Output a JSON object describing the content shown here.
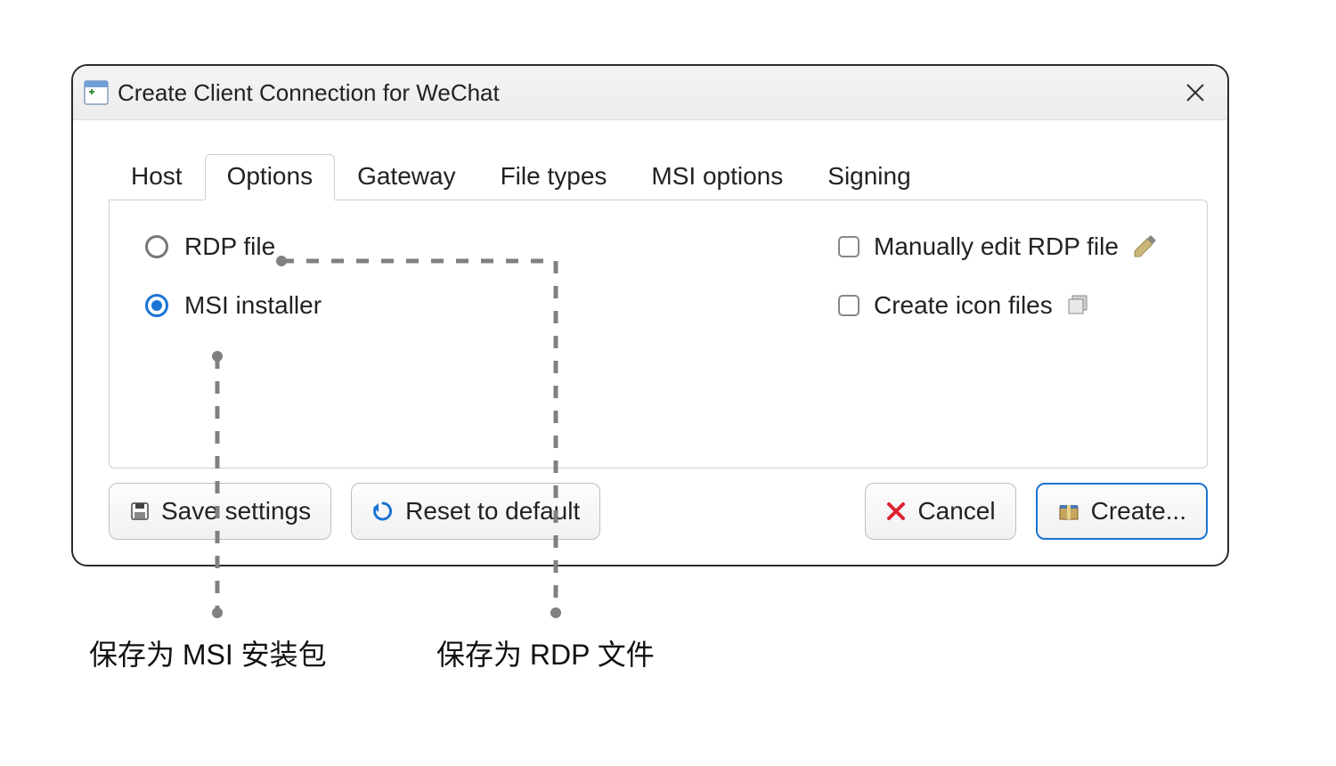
{
  "window": {
    "title": "Create Client Connection for WeChat"
  },
  "tabs": {
    "host": "Host",
    "options": "Options",
    "gateway": "Gateway",
    "file_types": "File types",
    "msi_options": "MSI options",
    "signing": "Signing",
    "active": "options"
  },
  "options_panel": {
    "radio_rdp": "RDP file",
    "radio_msi": "MSI installer",
    "selected_radio": "msi",
    "check_manual_edit": "Manually edit RDP file",
    "check_icon_files": "Create icon files"
  },
  "buttons": {
    "save_settings": "Save settings",
    "reset_default": "Reset to default",
    "cancel": "Cancel",
    "create": "Create..."
  },
  "annotations": {
    "msi_note": "保存为 MSI 安装包",
    "rdp_note": "保存为 RDP 文件"
  },
  "colors": {
    "accent": "#1a74d4",
    "border": "#2b2b2b",
    "dash": "#808080"
  }
}
